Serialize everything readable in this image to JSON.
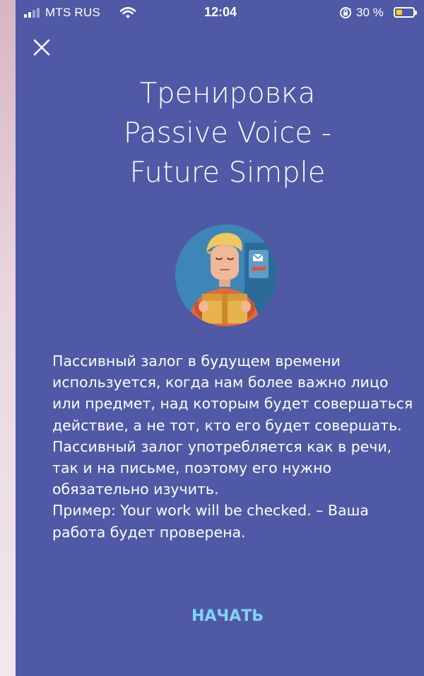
{
  "status_bar": {
    "carrier": "MTS RUS",
    "time": "12:04",
    "battery_percent": "30 %",
    "battery_level": 0.3,
    "icons": [
      "signal-icon",
      "wifi-icon",
      "rotation-lock-icon",
      "battery-icon"
    ]
  },
  "header": {
    "close_icon": "close-icon"
  },
  "title": {
    "line1": "Тренировка",
    "line2": "Passive Voice -",
    "line3": "Future Simple"
  },
  "illustration": {
    "icon": "courier-with-parcel-illustration"
  },
  "description": {
    "text": "Пассивный залог в будущем времени используется, когда нам более важно лицо или предмет, над которым будет совершаться действие, а не тот, кто его будет совершать. Пассивный залог употребляется как в речи, так и на письме, поэтому его нужно обязательно изучить.",
    "example": "Пример:  Your work will be checked.  – Ваша работа будет проверена."
  },
  "actions": {
    "start_label": "НАЧАТЬ"
  },
  "colors": {
    "background": "#5059a5",
    "accent": "#7fd4f5",
    "text": "#ffffff",
    "battery": "#ffd40a"
  }
}
